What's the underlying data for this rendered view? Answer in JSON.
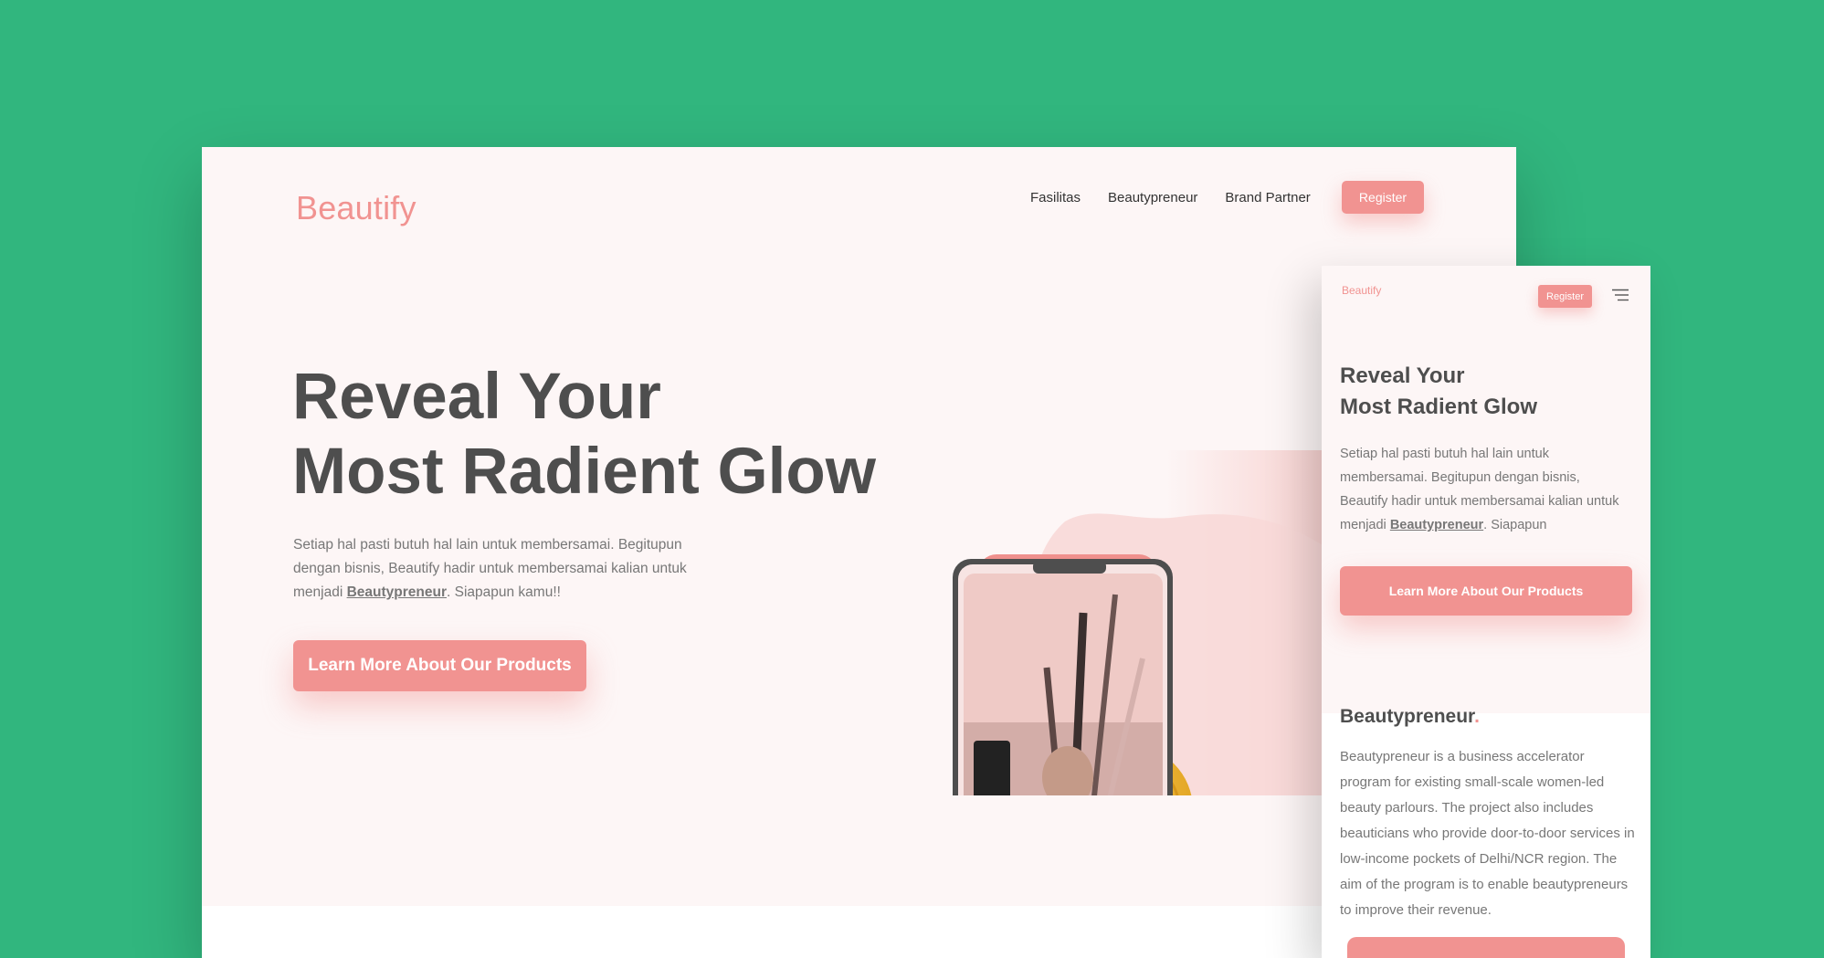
{
  "colors": {
    "background": "#31b67e",
    "brand": "#f19391",
    "heading": "#4e4e4e",
    "text": "#777777",
    "hero_bg": "#fdf6f6"
  },
  "desktop": {
    "brand": "Beautify",
    "nav": [
      "Fasilitas",
      "Beautypreneur",
      "Brand Partner"
    ],
    "register": "Register",
    "hero": {
      "title_line1": "Reveal Your",
      "title_line2": "Most Radient Glow",
      "desc_before": "Setiap hal pasti butuh hal lain untuk membersamai. Begitupun dengan bisnis, Beautify hadir untuk membersamai kalian untuk menjadi ",
      "desc_em": "Beautypreneur",
      "desc_after": ". Siapapun kamu!!",
      "cta": "Learn More About Our Products"
    }
  },
  "mobile": {
    "brand": "Beautify",
    "register": "Register",
    "menu_icon": "hamburger-icon",
    "hero": {
      "title_line1": "Reveal Your",
      "title_line2": "Most Radient Glow",
      "desc_before": "Setiap hal pasti butuh hal lain untuk membersamai. Begitupun dengan bisnis, Beautify hadir untuk membersamai kalian untuk menjadi ",
      "desc_em": "Beautypreneur",
      "desc_after": ". Siapapun",
      "cta": "Learn More About Our Products"
    },
    "section": {
      "title": "Beautypreneur",
      "title_dot": ".",
      "text": "Beautypreneur is a business accelerator program for existing small-scale women-led beauty parlours. The project also includes beauticians who provide door-to-door services in low-income pockets of Delhi/NCR region. The aim of the program is to enable beautypreneurs to improve their revenue."
    }
  }
}
